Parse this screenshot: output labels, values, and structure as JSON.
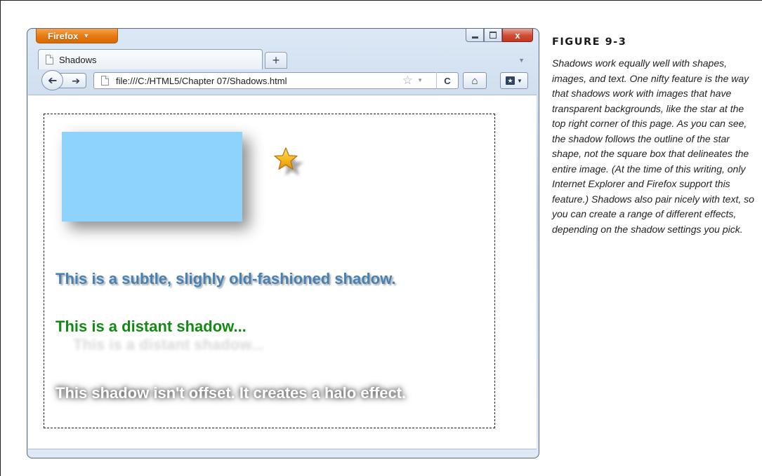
{
  "browser": {
    "app_button_label": "Firefox",
    "close_glyph": "x",
    "tab": {
      "title": "Shadows"
    },
    "new_tab_label": "+",
    "address": {
      "url": "file:///C:/HTML5/Chapter 07/Shadows.html"
    }
  },
  "page": {
    "subtle_text": "This is a subtle, slighly old-fashioned shadow.",
    "distant_text": "This is a distant shadow...",
    "halo_text": "This shadow isn't offset. It creates a halo effect.",
    "rect_color": "#8ed3fd",
    "subtle_color": "#4682b4",
    "distant_color": "#138a13"
  },
  "figure": {
    "label": "FIGURE 9-3",
    "caption": "Shadows work equally well with shapes, images, and text. One nifty feature is the way that shadows work with images that have transparent backgrounds, like the star at the top right corner of this page. As you can see, the shadow follows the outline of the star shape, not the square box that delineates the entire image. (At the time of this writing, only Internet Explorer and Firefox support this feature.) Shadows also pair nicely with text, so you can create a range of different effects, depending on the shadow settings you pick."
  },
  "icons": [
    "firefox-menu-caret-icon",
    "minimize-icon",
    "maximize-icon",
    "close-icon",
    "page-icon",
    "back-arrow-icon",
    "forward-arrow-icon",
    "bookmark-star-icon",
    "reload-icon",
    "home-icon",
    "bookmarks-icon",
    "star-image"
  ]
}
